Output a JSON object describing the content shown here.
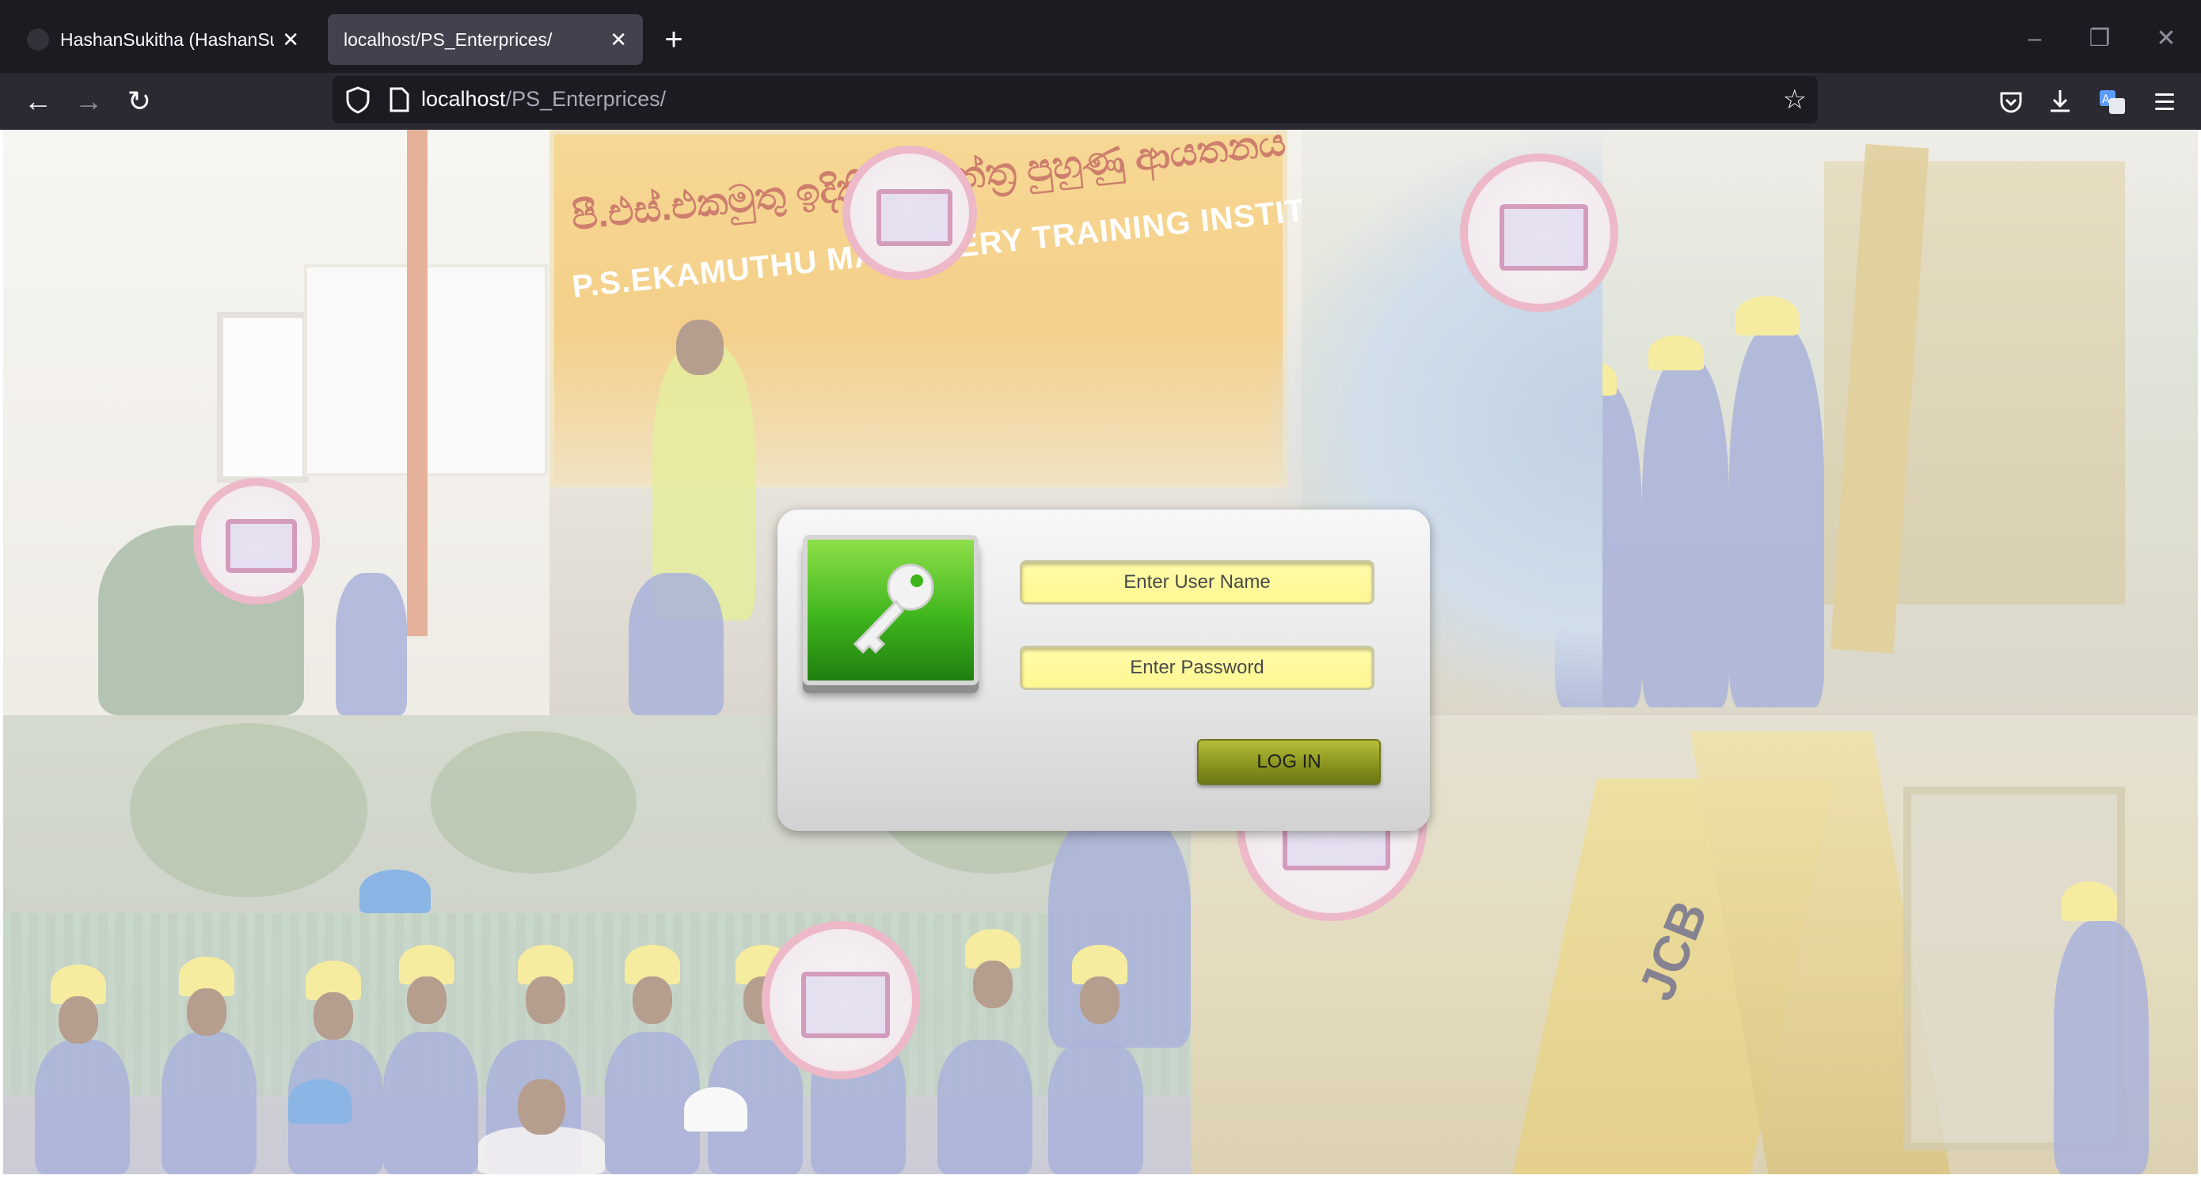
{
  "browser": {
    "tabs": [
      {
        "title": "HashanSukitha (HashanSukitha)",
        "active": false
      },
      {
        "title": "localhost/PS_Enterprices/",
        "active": true
      }
    ],
    "url": {
      "host": "localhost",
      "path": "/PS_Enterprices/"
    },
    "icons": {
      "back": "back-arrow-icon",
      "forward": "forward-arrow-icon",
      "reload": "reload-icon",
      "shield": "tracking-protection-shield-icon",
      "page": "page-icon",
      "bookmark": "star-icon",
      "pocket": "pocket-icon",
      "downloads": "download-icon",
      "translate": "translate-icon",
      "menu": "hamburger-menu-icon"
    }
  },
  "background": {
    "banner_sinhala": "පී.එස්.එකමුතු ඉදිකිරීම් යන්ත්‍ර පුහුණු ආයතනය",
    "banner_english": "P.S.EKAMUTHU MACHINERY TRAINING INSTITUTE",
    "jcb_logo": "JCB"
  },
  "login": {
    "username_placeholder": "Enter User Name",
    "password_placeholder": "Enter Password",
    "login_button": "LOG IN",
    "colors": {
      "field": "#fff792",
      "button": "#8b951e",
      "key_tile": "#3fb51c"
    }
  }
}
